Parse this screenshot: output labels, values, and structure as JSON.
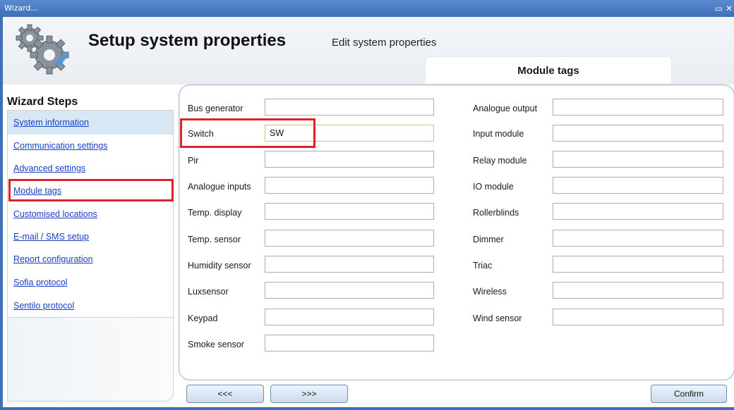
{
  "window": {
    "title": "Wizard..."
  },
  "header": {
    "title": "Setup system properties",
    "subtitle": "Edit system properties",
    "tab_label": "Module tags"
  },
  "sidebar": {
    "title": "Wizard Steps",
    "items": [
      {
        "label": "System information"
      },
      {
        "label": "Communication settings"
      },
      {
        "label": "Advanced settings"
      },
      {
        "label": "Module tags"
      },
      {
        "label": "Customised locations"
      },
      {
        "label": "E-mail / SMS setup"
      },
      {
        "label": "Report configuration"
      },
      {
        "label": "Sofia protocol"
      },
      {
        "label": "Sentilo protocol"
      }
    ]
  },
  "fields_left": [
    {
      "label": "Bus generator",
      "value": ""
    },
    {
      "label": "Switch",
      "value": "SW"
    },
    {
      "label": "Pir",
      "value": ""
    },
    {
      "label": "Analogue inputs",
      "value": ""
    },
    {
      "label": "Temp. display",
      "value": ""
    },
    {
      "label": "Temp. sensor",
      "value": ""
    },
    {
      "label": "Humidity sensor",
      "value": ""
    },
    {
      "label": "Luxsensor",
      "value": ""
    },
    {
      "label": "Keypad",
      "value": ""
    },
    {
      "label": "Smoke sensor",
      "value": ""
    }
  ],
  "fields_right": [
    {
      "label": "Analogue output",
      "value": ""
    },
    {
      "label": "Input module",
      "value": ""
    },
    {
      "label": "Relay module",
      "value": ""
    },
    {
      "label": "IO module",
      "value": ""
    },
    {
      "label": "Rollerblinds",
      "value": ""
    },
    {
      "label": "Dimmer",
      "value": ""
    },
    {
      "label": "Triac",
      "value": ""
    },
    {
      "label": "Wireless",
      "value": ""
    },
    {
      "label": "Wind sensor",
      "value": ""
    }
  ],
  "footer": {
    "prev_label": "<<<",
    "next_label": ">>>",
    "confirm_label": "Confirm"
  }
}
